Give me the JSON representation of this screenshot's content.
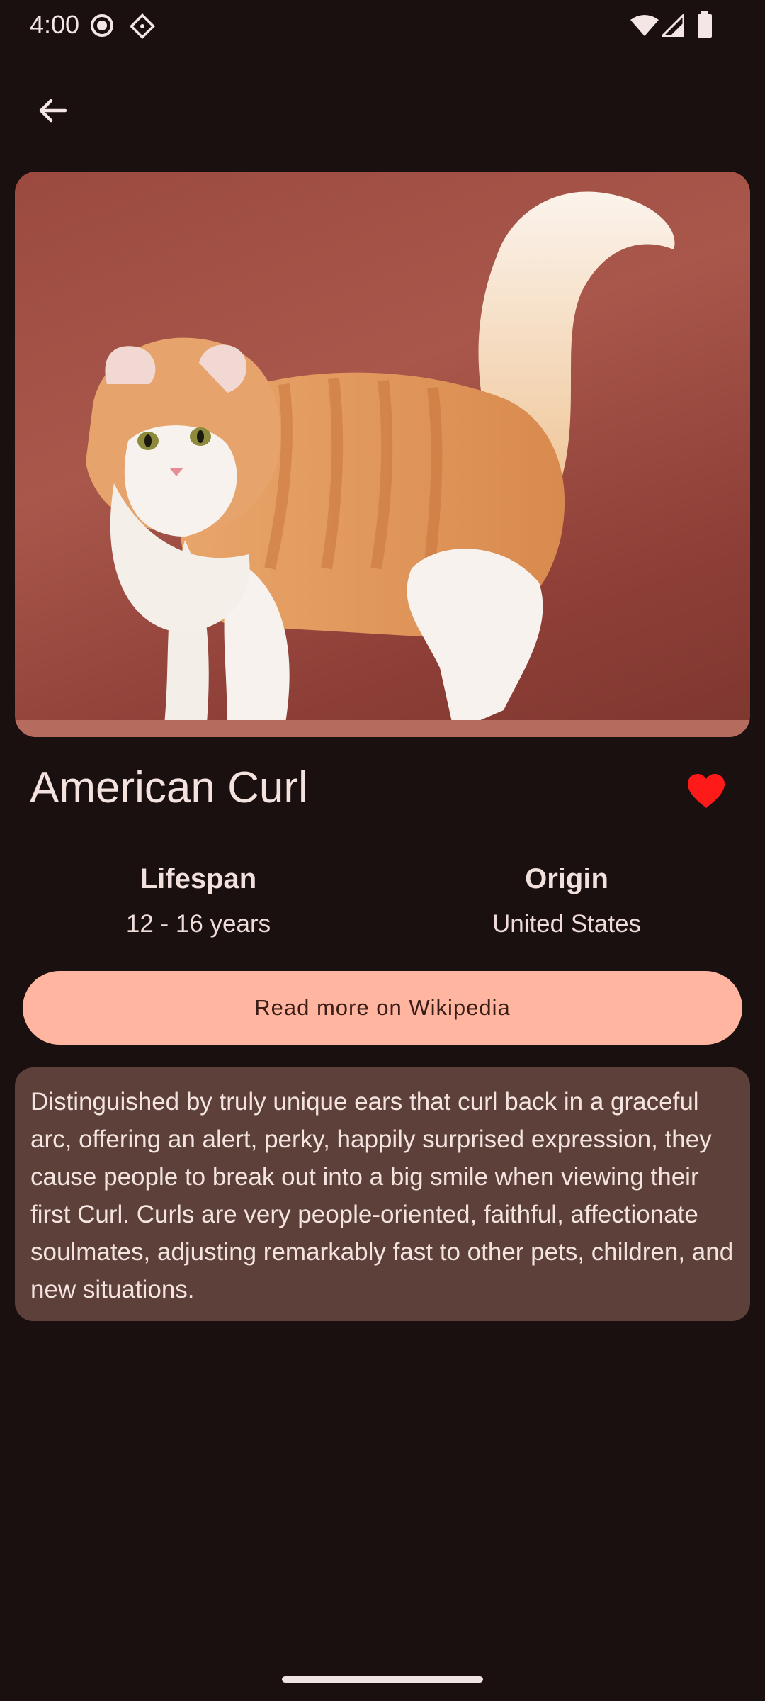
{
  "status_bar": {
    "time": "4:00",
    "icons": [
      "record-icon",
      "cast-diamond-icon",
      "wifi-icon",
      "cell-signal-icon",
      "battery-icon"
    ]
  },
  "toolbar": {
    "back_icon": "arrow-left-icon"
  },
  "breed": {
    "name": "American Curl",
    "favorite": true,
    "favorite_color": "#ff1a1a",
    "photo_description_icon": "cat-photo"
  },
  "stats": {
    "lifespan_label": "Lifespan",
    "lifespan_value": "12 - 16 years",
    "origin_label": "Origin",
    "origin_value": "United States"
  },
  "wiki_button": {
    "label": "Read more on Wikipedia",
    "color": "#ffb5a0"
  },
  "description": {
    "text": "Distinguished by truly unique ears that curl back in a graceful arc, offering an alert, perky, happily surprised expression, they cause people to break out into a big smile when viewing their first Curl. Curls are very people-oriented, faithful, affectionate soulmates, adjusting remarkably fast to other pets, children, and new situations."
  }
}
